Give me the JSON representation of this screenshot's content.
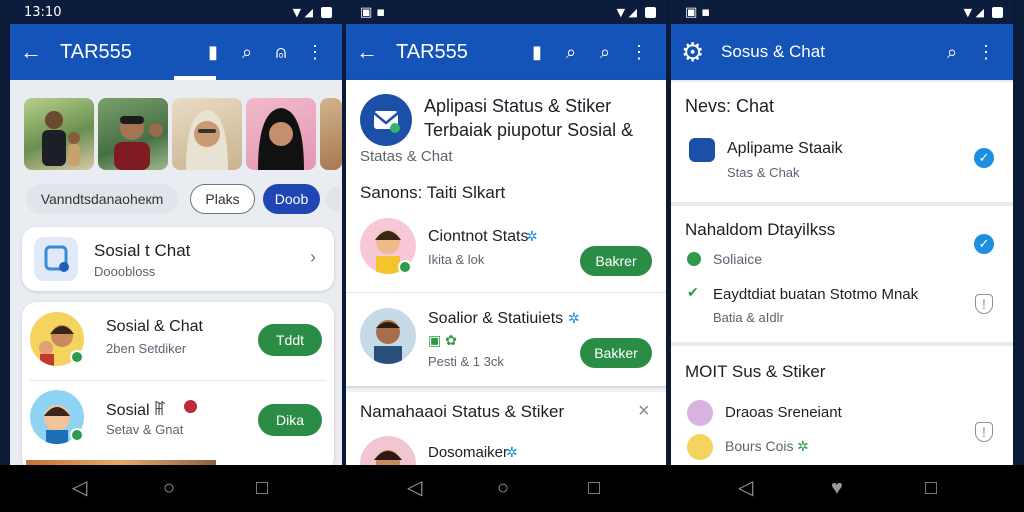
{
  "screens": [
    {
      "status_time": "13:10",
      "title": "TAR555",
      "filter_chips": [
        "Vanndtsdanaoheкm",
        "Plaks",
        "Doob"
      ],
      "chat_row": {
        "title": "Sosial t Chat",
        "subtitle": "Dooobloss"
      },
      "items": [
        {
          "title": "Sosial & Chat",
          "subtitle": "2ben Setdiker",
          "button": "Tddt"
        },
        {
          "title": "Sosial ꂵ",
          "subtitle": "Setav & Gnat",
          "button": "Dika"
        }
      ]
    },
    {
      "status_time": "",
      "title": "TAR555",
      "header_title_line1": "Aplipasi Status & Stiker",
      "header_title_line2": "Terbaiak piupotur Sosial &",
      "header_subtitle": "Statas & Chat",
      "section_title": "Sanons: Taiti Slkart",
      "items": [
        {
          "title": "Ciontnot Stats",
          "subtitle": "Ikita & lok",
          "button": "Bakrer"
        },
        {
          "title": "Soalior & Statiuiets",
          "subtitle": "Pesti & 1 3ck",
          "button": "Bakker"
        }
      ],
      "second_card_title": "Namahaaoi Status & Stiker",
      "second_card_item": "Dosomaiker"
    },
    {
      "status_time": "",
      "title": "Sosus & Chat",
      "section1": {
        "title": "Nevs: Chat",
        "item_title": "Aplipame Staaik",
        "item_subtitle": "Staꜱ & Chak"
      },
      "section2": {
        "title": "Nahaldom Dtayilkss",
        "row1": "Soliaice",
        "row2_title": "Eaydtdiat buatan Stotmo Mnak",
        "row2_subtitle": "Batia & aIdlr"
      },
      "section3": {
        "title": "MOIT Sus & Stiker",
        "row1": "Draoas Sreneiant",
        "row2": "Bours Cois"
      }
    }
  ],
  "icons": {
    "back": "arrow-back-icon",
    "search": "search-icon",
    "more": "more-vert-icon",
    "settings": "settings-gear-icon"
  },
  "colors": {
    "appbar": "#1453b8",
    "statusbar": "#0c1c3c",
    "accent_green": "#2b8c46",
    "check_blue": "#1d8fe0",
    "chip_selected": "#1f46b4"
  }
}
